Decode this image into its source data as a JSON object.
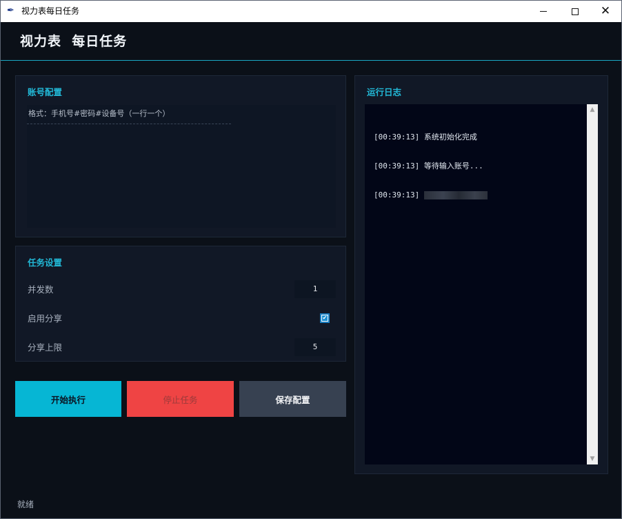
{
  "window": {
    "title": "视力表每日任务",
    "icon": "feather-icon"
  },
  "header": {
    "title": "视力表  每日任务"
  },
  "account_panel": {
    "title": "账号配置",
    "placeholder": "格式：手机号#密码#设备号（一行一个）",
    "value": ""
  },
  "task_panel": {
    "title": "任务设置",
    "concurrency_label": "并发数",
    "concurrency_value": "1",
    "share_label": "启用分享",
    "share_enabled": true,
    "share_limit_label": "分享上限",
    "share_limit_value": "5"
  },
  "buttons": {
    "start": "开始执行",
    "stop": "停止任务",
    "save": "保存配置"
  },
  "log_panel": {
    "title": "运行日志",
    "lines": [
      {
        "ts": "[00:39:13]",
        "msg": "系统初始化完成"
      },
      {
        "ts": "[00:39:13]",
        "msg": "等待输入账号..."
      },
      {
        "ts": "[00:39:13]",
        "msg": ""
      }
    ]
  },
  "status": {
    "text": "就绪"
  },
  "colors": {
    "accent": "#06b6d4",
    "danger": "#ef4444",
    "neutral": "#374151",
    "background": "#0b1018"
  }
}
